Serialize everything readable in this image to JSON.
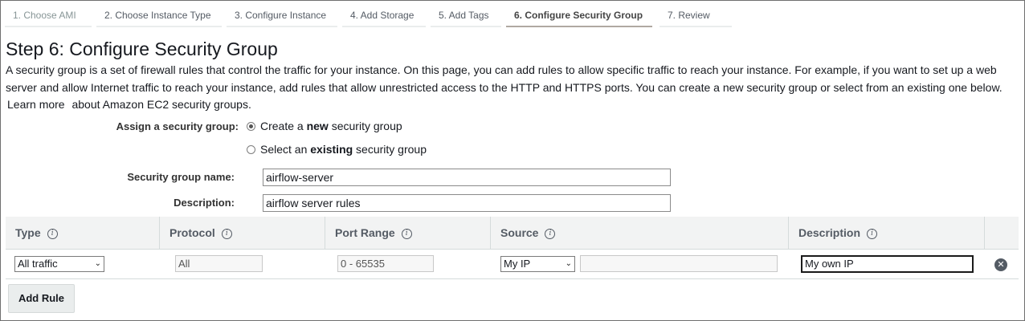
{
  "wizard": {
    "steps": [
      {
        "label": "1. Choose AMI"
      },
      {
        "label": "2. Choose Instance Type"
      },
      {
        "label": "3. Configure Instance"
      },
      {
        "label": "4. Add Storage"
      },
      {
        "label": "5. Add Tags"
      },
      {
        "label": "6. Configure Security Group"
      },
      {
        "label": "7. Review"
      }
    ],
    "active_step": 6
  },
  "page": {
    "title": "Step 6: Configure Security Group",
    "intro": "A security group is a set of firewall rules that control the traffic for your instance. On this page, you can add rules to allow specific traffic to reach your instance. For example, if you want to set up a web server and allow Internet traffic to reach your instance, add rules that allow unrestricted access to the HTTP and HTTPS ports. You can create a new security group or select from an existing one below.",
    "learn_more": "Learn more",
    "learn_more_suffix": "about Amazon EC2 security groups."
  },
  "assign": {
    "label": "Assign a security group:",
    "option_new": {
      "pre": "Create a ",
      "bold": "new",
      "post": " security group",
      "selected": true
    },
    "option_existing": {
      "pre": "Select an ",
      "bold": "existing",
      "post": " security group",
      "selected": false
    }
  },
  "form": {
    "name_label": "Security group name:",
    "name_value": "airflow-server",
    "desc_label": "Description:",
    "desc_value": "airflow server rules"
  },
  "rules_table": {
    "columns": [
      "Type",
      "Protocol",
      "Port Range",
      "Source",
      "Description"
    ],
    "info_icon": "i",
    "rows": [
      {
        "type": "All traffic",
        "protocol": "All",
        "port_range": "0 - 65535",
        "source": "My IP",
        "source_cidr": "",
        "description": "My own IP"
      }
    ]
  },
  "actions": {
    "add_rule": "Add Rule"
  },
  "colors": {
    "active_step_underline": "#b0a9a2",
    "header_bg": "#f2f3f3",
    "button_bg": "#eaeded"
  }
}
